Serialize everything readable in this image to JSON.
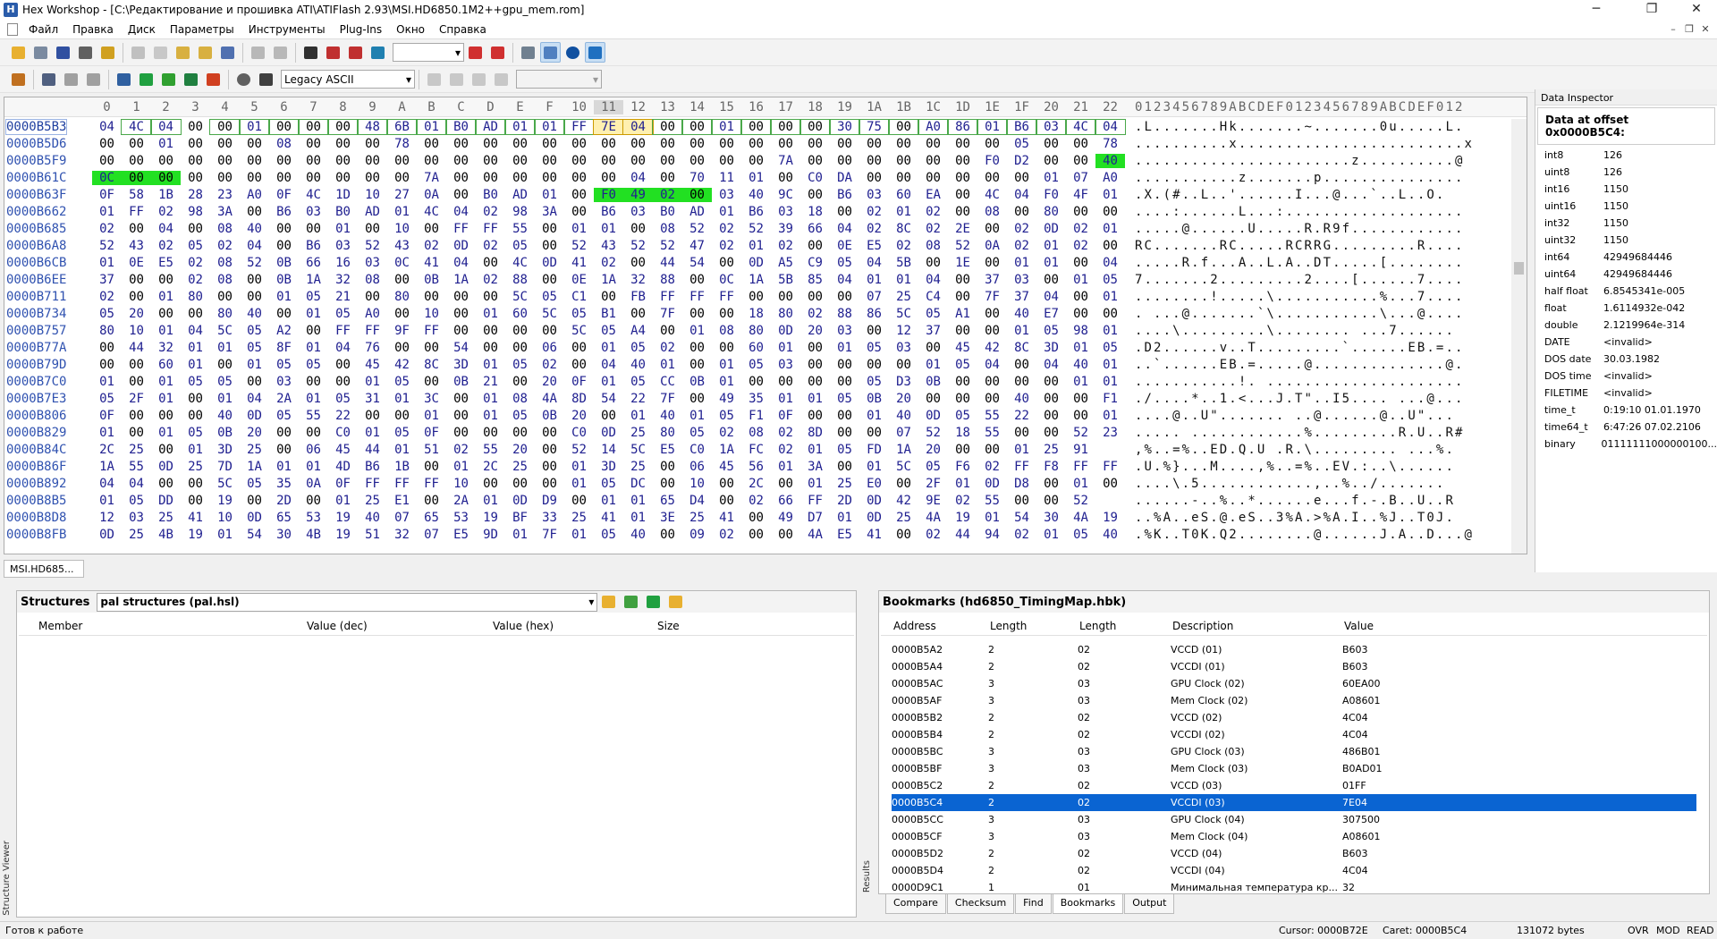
{
  "window": {
    "title": "Hex Workshop - [C:\\Редактирование и прошивка ATI\\ATIFlash 2.93\\MSI.HD6850.1M2++gpu_mem.rom]",
    "minimize": "─",
    "maximize": "❐",
    "close": "✕"
  },
  "menu": [
    "Файл",
    "Правка",
    "Диск",
    "Параметры",
    "Инструменты",
    "Plug-Ins",
    "Окно",
    "Справка"
  ],
  "toolbar2": {
    "charset": "Legacy ASCII"
  },
  "hex": {
    "columns": [
      "0",
      "1",
      "2",
      "3",
      "4",
      "5",
      "6",
      "7",
      "8",
      "9",
      "A",
      "B",
      "C",
      "D",
      "E",
      "F",
      "10",
      "11",
      "12",
      "13",
      "14",
      "15",
      "16",
      "17",
      "18",
      "19",
      "1A",
      "1B",
      "1C",
      "1D",
      "1E",
      "1F",
      "20",
      "21",
      "22"
    ],
    "ascii_header": "0123456789ABCDEF0123456789ABCDEF012",
    "rows": [
      {
        "a": "0000B5B3",
        "b": "04 4C 04 00 00 01 00 00 00 48 6B 01 B0 AD 01 01 FF 7E 04 00 00 01 00 00 00 30 75 00 A0 86 01 B6 03 4C 04",
        "t": ".L.......Hk.......~.......0u.....L."
      },
      {
        "a": "0000B5D6",
        "b": "00 00 01 00 00 00 08 00 00 00 78 00 00 00 00 00 00 00 00 00 00 00 00 00 00 00 00 00 00 00 00 05 00 00 78",
        "t": "..........x........................x"
      },
      {
        "a": "0000B5F9",
        "b": "00 00 00 00 00 00 00 00 00 00 00 00 00 00 00 00 00 00 00 00 00 00 00 7A 00 00 00 00 00 00 F0 D2 00 00 40",
        "t": ".......................z..........@"
      },
      {
        "a": "0000B61C",
        "b": "0C 00 00 00 00 00 00 00 00 00 00 7A 00 00 00 00 00 00 04 00 70 11 01 00 C0 DA 00 00 00 00 00 00 01 07 A0",
        "t": "...........z.......p..............."
      },
      {
        "a": "0000B63F",
        "b": "0F 58 1B 28 23 A0 0F 4C 1D 10 27 0A 00 B0 AD 01 00 F0 49 02 00 03 40 9C 00 B6 03 60 EA 00 4C 04 F0 4F 01",
        "t": ".X.(#..L..'......I...@...`..L..O."
      },
      {
        "a": "0000B662",
        "b": "01 FF 02 98 3A 00 B6 03 B0 AD 01 4C 04 02 98 3A 00 B6 03 B0 AD 01 B6 03 18 00 02 01 02 00 08 00 80 00 00",
        "t": "....:......L...:..................."
      },
      {
        "a": "0000B685",
        "b": "02 00 04 00 08 40 00 00 01 00 10 00 FF FF 55 00 01 01 00 08 52 02 52 39 66 04 02 8C 02 2E 00 02 0D 02 01",
        "t": ".....@......U.....R.R9f............"
      },
      {
        "a": "0000B6A8",
        "b": "52 43 02 05 02 04 00 B6 03 52 43 02 0D 02 05 00 52 43 52 52 47 02 01 02 00 0E E5 02 08 52 0A 02 01 02 00",
        "t": "RC.......RC.....RCRRG.........R...."
      },
      {
        "a": "0000B6CB",
        "b": "01 0E E5 02 08 52 0B 66 16 03 0C 41 04 00 4C 0D 41 02 00 44 54 00 0D A5 C9 05 04 5B 00 1E 00 01 01 00 04",
        "t": ".....R.f...A..L.A..DT.....[........"
      },
      {
        "a": "0000B6EE",
        "b": "37 00 00 02 08 00 0B 1A 32 08 00 0B 1A 02 88 00 0E 1A 32 88 00 0C 1A 5B 85 04 01 01 04 00 37 03 00 01 05",
        "t": "7.......2.........2....[......7...."
      },
      {
        "a": "0000B711",
        "b": "02 00 01 80 00 00 01 05 21 00 80 00 00 00 5C 05 C1 00 FB FF FF FF 00 00 00 00 07 25 C4 00 7F 37 04 00 01",
        "t": "........!.....\\...........%...7...."
      },
      {
        "a": "0000B734",
        "b": "05 20 00 00 80 40 00 01 05 A0 00 10 00 01 60 5C 05 B1 00 7F 00 00 18 80 02 88 86 5C 05 A1 00 40 E7 00 00",
        "t": ". ...@.......`\\...........\\...@...."
      },
      {
        "a": "0000B757",
        "b": "80 10 01 04 5C 05 A2 00 FF FF 9F FF 00 00 00 00 5C 05 A4 00 01 08 80 0D 20 03 00 12 37 00 00 01 05 98 01",
        "t": "....\\.........\\........ ...7......"
      },
      {
        "a": "0000B77A",
        "b": "00 44 32 01 01 05 8F 01 04 76 00 00 54 00 00 06 00 01 05 02 00 00 60 01 00 01 05 03 00 45 42 8C 3D 01 05",
        "t": ".D2......v..T.........`......EB.=.."
      },
      {
        "a": "0000B79D",
        "b": "00 00 60 01 00 01 05 05 00 45 42 8C 3D 01 05 02 00 04 40 01 00 01 05 03 00 00 00 00 01 05 04 00 04 40 01",
        "t": "..`......EB.=.....@..............@."
      },
      {
        "a": "0000B7C0",
        "b": "01 00 01 05 05 00 03 00 00 01 05 00 0B 21 00 20 0F 01 05 CC 0B 01 00 00 00 00 05 D3 0B 00 00 00 00 01 01",
        "t": "...........!. ....................."
      },
      {
        "a": "0000B7E3",
        "b": "05 2F 01 00 01 04 2A 01 05 31 01 3C 00 01 08 4A 8D 54 22 7F 00 49 35 01 01 05 0B 20 00 00 00 40 00 00 F1",
        "t": "./....*..1.<...J.T\"..I5.... ...@..."
      },
      {
        "a": "0000B806",
        "b": "0F 00 00 00 40 0D 05 55 22 00 00 01 00 01 05 0B 20 00 01 40 01 05 F1 0F 00 00 01 40 0D 05 55 22 00 00 01",
        "t": "....@..U\"....... ..@......@..U\"..."
      },
      {
        "a": "0000B829",
        "b": "01 00 01 05 0B 20 00 00 C0 01 05 0F 00 00 00 00 C0 0D 25 80 05 02 08 02 8D 00 00 07 52 18 55 00 00 52 23",
        "t": "..... ............%.........R.U..R#"
      },
      {
        "a": "0000B84C",
        "b": "2C 25 00 01 3D 25 00 06 45 44 01 51 02 55 20 00 52 14 5C E5 C0 1A FC 02 01 05 FD 1A 20 00 00 01 25 91",
        "t": ",%..=%..ED.Q.U .R.\\......... ...%."
      },
      {
        "a": "0000B86F",
        "b": "1A 55 0D 25 7D 1A 01 01 4D B6 1B 00 01 2C 25 00 01 3D 25 00 06 45 56 01 3A 00 01 5C 05 F6 02 FF F8 FF FF",
        "t": ".U.%}...M....,%..=%..EV.:..\\......"
      },
      {
        "a": "0000B892",
        "b": "04 04 00 00 5C 05 35 0A 0F FF FF FF 10 00 00 00 01 05 DC 00 10 00 2C 00 01 25 E0 00 2F 01 0D D8 00 01 00",
        "t": "....\\.5............,..%../......."
      },
      {
        "a": "0000B8B5",
        "b": "01 05 DD 00 19 00 2D 00 01 25 E1 00 2A 01 0D D9 00 01 01 65 D4 00 02 66 FF 2D 0D 42 9E 02 55 00 00 52",
        "t": "......-..%..*......e...f.-.B..U..R"
      },
      {
        "a": "0000B8D8",
        "b": "12 03 25 41 10 0D 65 53 19 40 07 65 53 19 BF 33 25 41 01 3E 25 41 00 49 D7 01 0D 25 4A 19 01 54 30 4A 19",
        "t": "..%A..eS.@.eS..3%A.>%A.I..%J..T0J."
      },
      {
        "a": "0000B8FB",
        "b": "0D 25 4B 19 01 54 30 4B 19 51 32 07 E5 9D 01 7F 01 05 40 00 09 02 00 00 4A E5 41 00 02 44 94 02 01 05 40",
        "t": ".%K..T0K.Q2........@......J.A..D...@"
      }
    ]
  },
  "inspector": {
    "title": "Data Inspector",
    "header": "Data at offset 0x0000B5C4:",
    "rows": [
      {
        "k": "int8",
        "v": "126"
      },
      {
        "k": "uint8",
        "v": "126"
      },
      {
        "k": "int16",
        "v": "1150"
      },
      {
        "k": "uint16",
        "v": "1150"
      },
      {
        "k": "int32",
        "v": "1150"
      },
      {
        "k": "uint32",
        "v": "1150"
      },
      {
        "k": "int64",
        "v": "42949684446"
      },
      {
        "k": "uint64",
        "v": "42949684446"
      },
      {
        "k": "half float",
        "v": "6.8545341e-005"
      },
      {
        "k": "float",
        "v": "1.6114932e-042"
      },
      {
        "k": "double",
        "v": "2.1219964e-314"
      },
      {
        "k": "DATE",
        "v": "<invalid>"
      },
      {
        "k": "DOS date",
        "v": "30.03.1982"
      },
      {
        "k": "DOS time",
        "v": "<invalid>"
      },
      {
        "k": "FILETIME",
        "v": "<invalid>"
      },
      {
        "k": "time_t",
        "v": "0:19:10 01.01.1970"
      },
      {
        "k": "time64_t",
        "v": "6:47:26 07.02.2106"
      },
      {
        "k": "binary",
        "v": "01111111000000100..."
      }
    ]
  },
  "doc_tab": "MSI.HD685...",
  "structures": {
    "label": "Structures",
    "file": "pal structures (pal.hsl)",
    "cols": [
      "Member",
      "Value (dec)",
      "Value (hex)",
      "Size"
    ],
    "side": "Structure Viewer"
  },
  "bookmarks": {
    "title": "Bookmarks (hd6850_TimingMap.hbk)",
    "cols": [
      "Address",
      "Length",
      "Length",
      "Description",
      "Value"
    ],
    "side": "Results",
    "rows": [
      {
        "addr": "0000B5A2",
        "l1": "2",
        "l2": "02",
        "d": "VCCD (01)",
        "v": "B603"
      },
      {
        "addr": "0000B5A4",
        "l1": "2",
        "l2": "02",
        "d": "VCCDI (01)",
        "v": "B603"
      },
      {
        "addr": "0000B5AC",
        "l1": "3",
        "l2": "03",
        "d": "GPU Clock (02)",
        "v": "60EA00"
      },
      {
        "addr": "0000B5AF",
        "l1": "3",
        "l2": "03",
        "d": "Mem Clock (02)",
        "v": "A08601"
      },
      {
        "addr": "0000B5B2",
        "l1": "2",
        "l2": "02",
        "d": "VCCD (02)",
        "v": "4C04"
      },
      {
        "addr": "0000B5B4",
        "l1": "2",
        "l2": "02",
        "d": "VCCDI (02)",
        "v": "4C04"
      },
      {
        "addr": "0000B5BC",
        "l1": "3",
        "l2": "03",
        "d": "GPU Clock (03)",
        "v": "486B01"
      },
      {
        "addr": "0000B5BF",
        "l1": "3",
        "l2": "03",
        "d": "Mem Clock (03)",
        "v": "B0AD01"
      },
      {
        "addr": "0000B5C2",
        "l1": "2",
        "l2": "02",
        "d": "VCCD (03)",
        "v": "01FF"
      },
      {
        "addr": "0000B5C4",
        "l1": "2",
        "l2": "02",
        "d": "VCCDI (03)",
        "v": "7E04"
      },
      {
        "addr": "0000B5CC",
        "l1": "3",
        "l2": "03",
        "d": "GPU Clock (04)",
        "v": "307500"
      },
      {
        "addr": "0000B5CF",
        "l1": "3",
        "l2": "03",
        "d": "Mem Clock (04)",
        "v": "A08601"
      },
      {
        "addr": "0000B5D2",
        "l1": "2",
        "l2": "02",
        "d": "VCCD (04)",
        "v": "B603"
      },
      {
        "addr": "0000B5D4",
        "l1": "2",
        "l2": "02",
        "d": "VCCDI (04)",
        "v": "4C04"
      },
      {
        "addr": "0000D9C1",
        "l1": "1",
        "l2": "01",
        "d": "Минимальная температура кр...",
        "v": "32"
      }
    ],
    "selected_index": 9
  },
  "bottom_tabs": [
    "Compare",
    "Checksum",
    "Find",
    "Bookmarks",
    "Output"
  ],
  "status": {
    "left": "Готов к работе",
    "cursor": "Cursor: 0000B72E",
    "caret": "Caret: 0000B5C4",
    "size": "131072 bytes",
    "ovr": "OVR",
    "mod": "MOD",
    "read": "READ"
  },
  "colors": {
    "highlight": "#22e022",
    "selection": "#0a64d2",
    "address": "#3052b0"
  }
}
